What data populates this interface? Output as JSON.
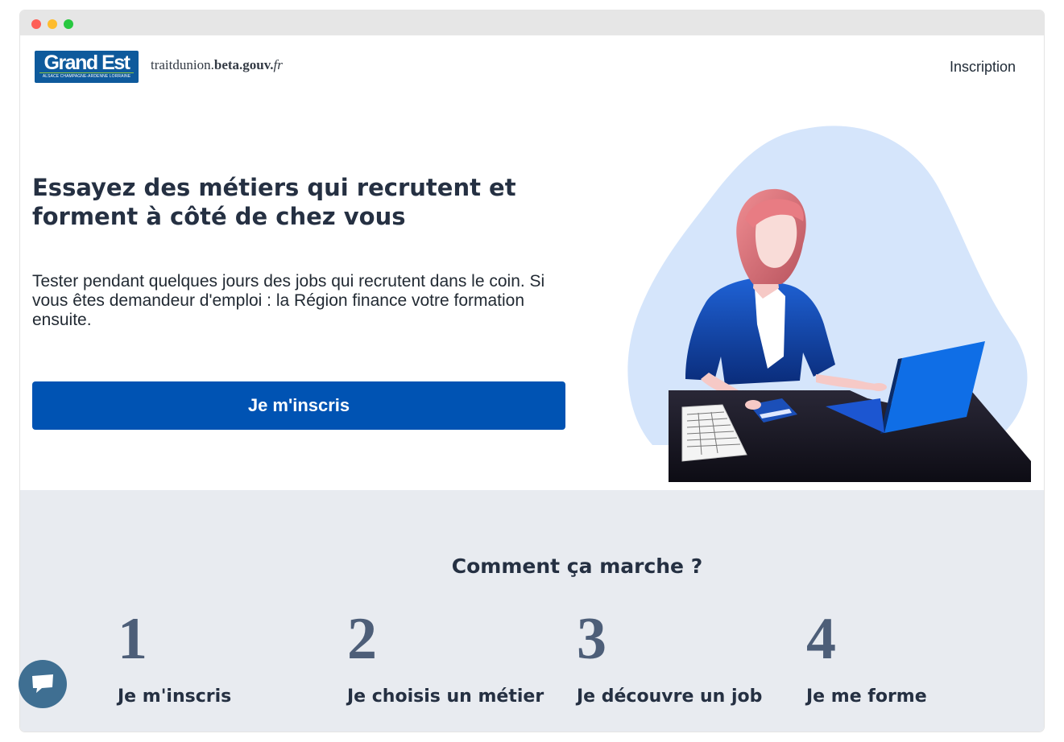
{
  "window": {
    "controls": [
      "close",
      "minimize",
      "maximize"
    ]
  },
  "header": {
    "logo": {
      "title": "Grand Est",
      "subtitle": "ALSACE CHAMPAGNE-ARDENNE LORRAINE"
    },
    "site_name": {
      "prefix": "traitdunion.",
      "bold": "beta.gouv.",
      "suffix": "fr"
    },
    "nav": {
      "inscription": "Inscription"
    }
  },
  "hero": {
    "title": "Essayez des métiers qui recrutent et forment à côté de chez vous",
    "text": "Tester pendant quelques jours des jobs qui recrutent dans le coin. Si vous êtes demandeur d'emploi : la Région finance votre formation ensuite.",
    "cta_label": "Je m'inscris"
  },
  "how": {
    "title": "Comment ça marche ?",
    "steps": [
      {
        "number": "1",
        "label": "Je m'inscris"
      },
      {
        "number": "2",
        "label": "Je choisis un métier"
      },
      {
        "number": "3",
        "label": "Je découvre un job"
      },
      {
        "number": "4",
        "label": "Je me forme"
      }
    ]
  },
  "colors": {
    "primary": "#0053b3",
    "section_bg": "#e8ebf0",
    "title": "#253042",
    "step_number": "#4d5e78",
    "chat": "#3f6f92",
    "blob": "#d5e5fb"
  },
  "icons": {
    "chat": "chat-bubble-icon",
    "illustration": "woman-at-laptop-illustration"
  }
}
